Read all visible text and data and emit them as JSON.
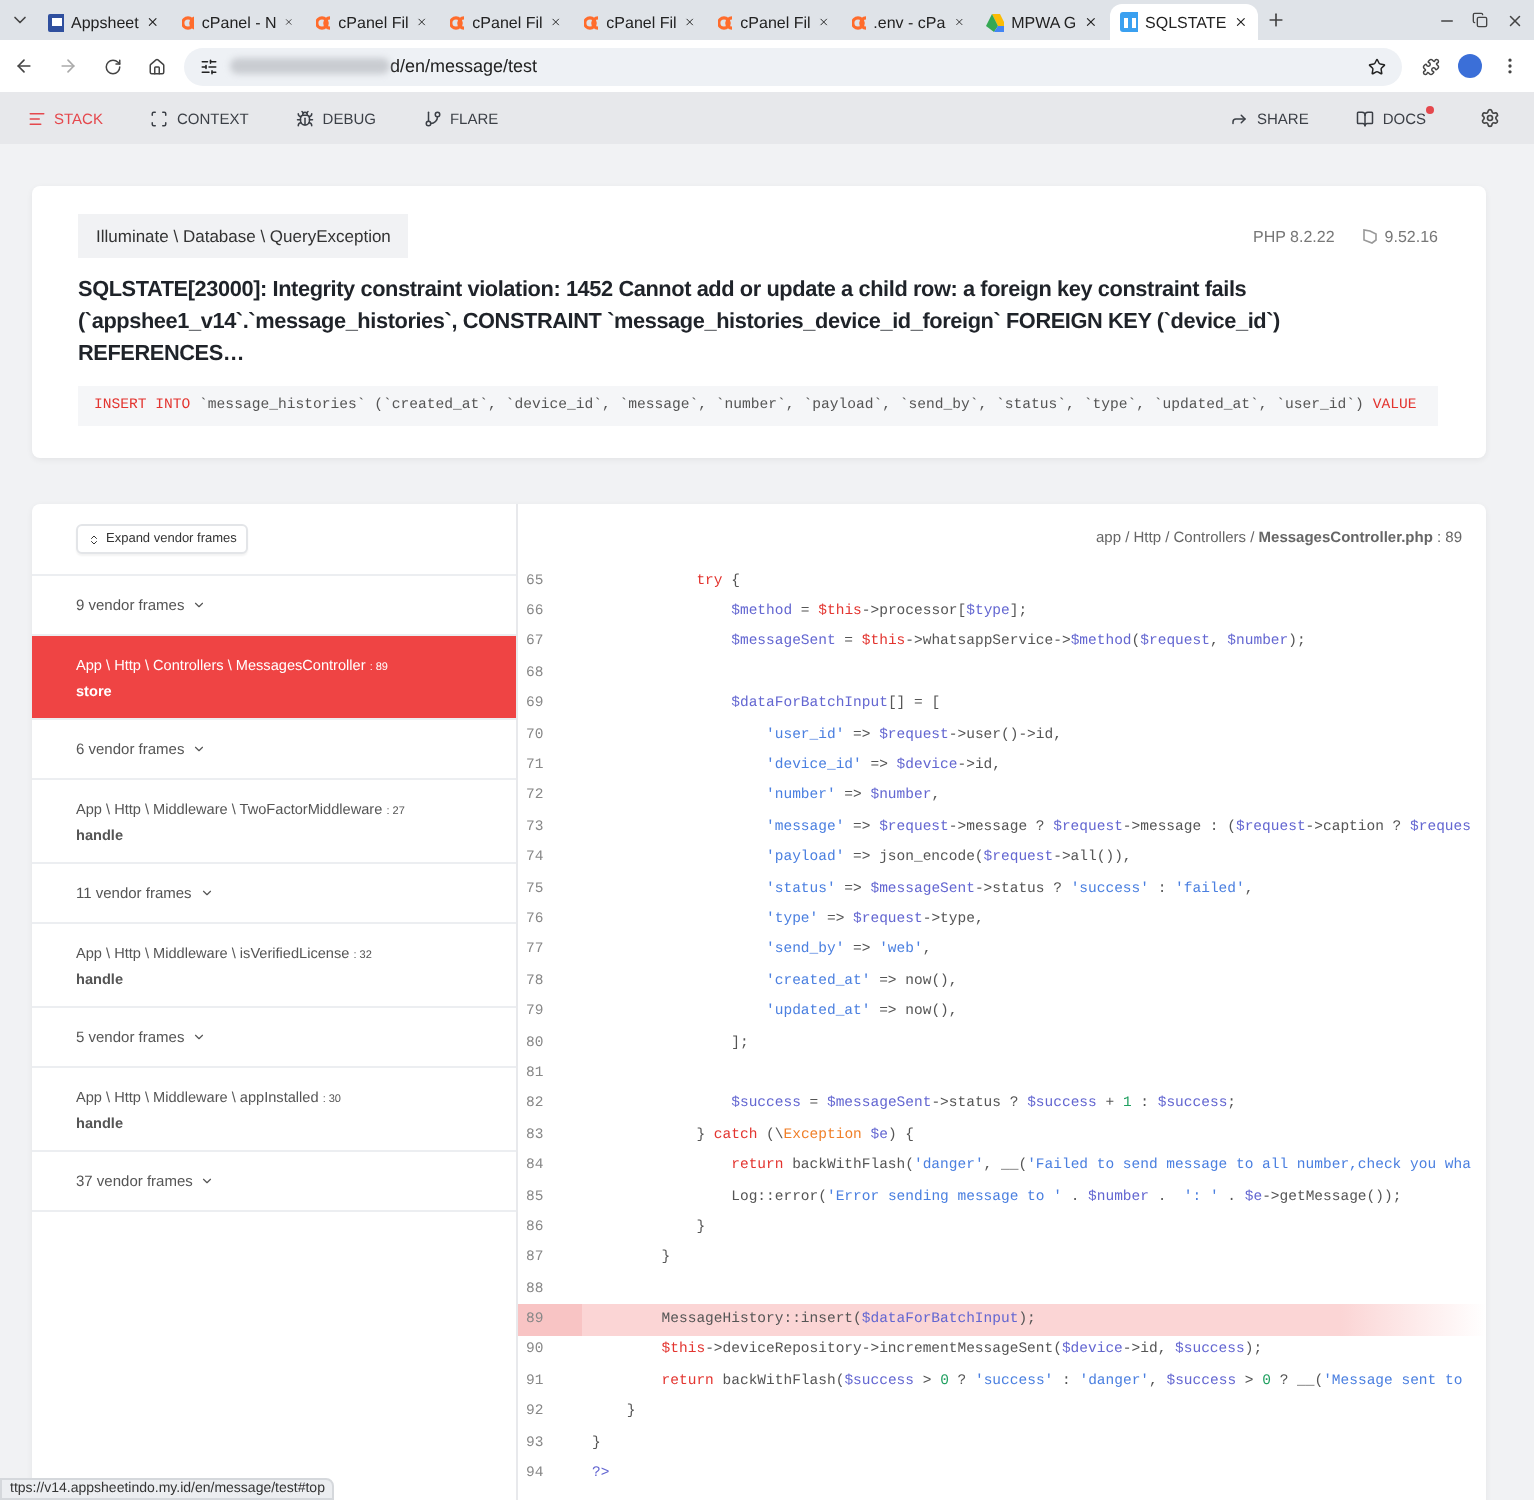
{
  "browser": {
    "tabs": [
      {
        "kind": "app",
        "title": "Appsheet",
        "selected": false
      },
      {
        "kind": "cpanel",
        "title": "cPanel - N",
        "selected": false
      },
      {
        "kind": "cpanel",
        "title": "cPanel Fil",
        "selected": false
      },
      {
        "kind": "cpanel",
        "title": "cPanel Fil",
        "selected": false
      },
      {
        "kind": "cpanel",
        "title": "cPanel Fil",
        "selected": false
      },
      {
        "kind": "cpanel",
        "title": "cPanel Fil",
        "selected": false
      },
      {
        "kind": "cpanel",
        "title": ".env - cPa",
        "selected": false
      },
      {
        "kind": "drive",
        "title": "MPWA G",
        "selected": false
      },
      {
        "kind": "ignition",
        "title": "SQLSTATE",
        "selected": true
      }
    ],
    "address": "d/en/message/test",
    "status_url": "ttps://v14.appsheetindo.my.id/en/message/test#top"
  },
  "nav": {
    "left": [
      {
        "kind": "stack",
        "label": "STACK",
        "selected": true
      },
      {
        "kind": "context",
        "label": "CONTEXT",
        "selected": false
      },
      {
        "kind": "debug",
        "label": "DEBUG",
        "selected": false
      },
      {
        "kind": "flare",
        "label": "FLARE",
        "selected": false
      }
    ],
    "right": [
      {
        "kind": "share",
        "label": "SHARE",
        "notification": false
      },
      {
        "kind": "docs",
        "label": "DOCS",
        "notification": true
      }
    ]
  },
  "exception": {
    "class": "Illuminate \\ Database \\ QueryException",
    "php": "PHP 8.2.22",
    "laravel": "9.52.16",
    "message": "SQLSTATE[23000]: Integrity constraint violation: 1452 Cannot add or update a child row: a foreign key constraint fails (`appshee1_v14`.`message_histories`, CONSTRAINT `message_histories_device_id_foreign` FOREIGN KEY (`device_id`) REFERENCES…",
    "sql": [
      {
        "kind": "keyword",
        "text": "INSERT INTO"
      },
      {
        "kind": "plain",
        "text": " `message_histories` (`created_at`, `device_id`, `message`, `number`, `payload`, `send_by`, `status`, `type`, `updated_at`, `user_id`) "
      },
      {
        "kind": "keyword",
        "text": "VALUE"
      }
    ]
  },
  "stack": {
    "expand_button": "Expand vendor frames",
    "frames": [
      {
        "kind": "vendor",
        "label": "9 vendor frames"
      },
      {
        "kind": "frame",
        "path": "App \\ Http \\ Controllers \\ MessagesController",
        "line": ": 89",
        "method": "store",
        "selected": true
      },
      {
        "kind": "vendor",
        "label": "6 vendor frames"
      },
      {
        "kind": "frame",
        "path": "App \\ Http \\ Middleware \\ TwoFactorMiddleware",
        "line": ": 27",
        "method": "handle",
        "selected": false
      },
      {
        "kind": "vendor",
        "label": "11 vendor frames"
      },
      {
        "kind": "frame",
        "path": "App \\ Http \\ Middleware \\ isVerifiedLicense",
        "line": ": 32",
        "method": "handle",
        "selected": false
      },
      {
        "kind": "vendor",
        "label": "5 vendor frames"
      },
      {
        "kind": "frame",
        "path": "App \\ Http \\ Middleware \\ appInstalled",
        "line": ": 30",
        "method": "handle",
        "selected": false
      },
      {
        "kind": "vendor",
        "label": "37 vendor frames"
      }
    ]
  },
  "code": {
    "file": "app / Http / Controllers / **MessagesController.php** : 89",
    "lines": [
      {
        "number": "65",
        "highlighted": false,
        "tokens": [
          {
            "kind": "keyword",
            "text": "            try"
          },
          {
            "kind": "plain",
            "text": " {"
          }
        ]
      },
      {
        "number": "66",
        "highlighted": false,
        "tokens": [
          {
            "kind": "variable",
            "text": "                $method"
          },
          {
            "kind": "plain",
            "text": " = "
          },
          {
            "kind": "keyword",
            "text": "$this"
          },
          {
            "kind": "plain",
            "text": "->processor["
          },
          {
            "kind": "variable",
            "text": "$type"
          },
          {
            "kind": "plain",
            "text": "];"
          }
        ]
      },
      {
        "number": "67",
        "highlighted": false,
        "tokens": [
          {
            "kind": "variable",
            "text": "                $messageSent"
          },
          {
            "kind": "plain",
            "text": " = "
          },
          {
            "kind": "keyword",
            "text": "$this"
          },
          {
            "kind": "plain",
            "text": "->whatsappService->"
          },
          {
            "kind": "variable",
            "text": "$method"
          },
          {
            "kind": "plain",
            "text": "("
          },
          {
            "kind": "variable",
            "text": "$request"
          },
          {
            "kind": "plain",
            "text": ", "
          },
          {
            "kind": "variable",
            "text": "$number"
          },
          {
            "kind": "plain",
            "text": ");"
          }
        ]
      },
      {
        "number": "68",
        "highlighted": false
      },
      {
        "number": "69",
        "highlighted": false,
        "tokens": [
          {
            "kind": "variable",
            "text": "                $dataForBatchInput"
          },
          {
            "kind": "plain",
            "text": "[] = ["
          }
        ]
      },
      {
        "number": "70",
        "highlighted": false,
        "tokens": [
          {
            "kind": "string",
            "text": "                    'user_id'"
          },
          {
            "kind": "plain",
            "text": " => "
          },
          {
            "kind": "variable",
            "text": "$request"
          },
          {
            "kind": "plain",
            "text": "->user()->id,"
          }
        ]
      },
      {
        "number": "71",
        "highlighted": false,
        "tokens": [
          {
            "kind": "string",
            "text": "                    'device_id'"
          },
          {
            "kind": "plain",
            "text": " => "
          },
          {
            "kind": "variable",
            "text": "$device"
          },
          {
            "kind": "plain",
            "text": "->id,"
          }
        ]
      },
      {
        "number": "72",
        "highlighted": false,
        "tokens": [
          {
            "kind": "string",
            "text": "                    'number'"
          },
          {
            "kind": "plain",
            "text": " => "
          },
          {
            "kind": "variable",
            "text": "$number"
          },
          {
            "kind": "plain",
            "text": ","
          }
        ]
      },
      {
        "number": "73",
        "highlighted": false,
        "tokens": [
          {
            "kind": "string",
            "text": "                    'message'"
          },
          {
            "kind": "plain",
            "text": " => "
          },
          {
            "kind": "variable",
            "text": "$request"
          },
          {
            "kind": "plain",
            "text": "->message ? "
          },
          {
            "kind": "variable",
            "text": "$request"
          },
          {
            "kind": "plain",
            "text": "->message : ("
          },
          {
            "kind": "variable",
            "text": "$request"
          },
          {
            "kind": "plain",
            "text": "->caption ? "
          },
          {
            "kind": "variable",
            "text": "$reques"
          }
        ]
      },
      {
        "number": "74",
        "highlighted": false,
        "tokens": [
          {
            "kind": "string",
            "text": "                    'payload'"
          },
          {
            "kind": "plain",
            "text": " => json_encode("
          },
          {
            "kind": "variable",
            "text": "$request"
          },
          {
            "kind": "plain",
            "text": "->all()),"
          }
        ]
      },
      {
        "number": "75",
        "highlighted": false,
        "tokens": [
          {
            "kind": "string",
            "text": "                    'status'"
          },
          {
            "kind": "plain",
            "text": " => "
          },
          {
            "kind": "variable",
            "text": "$messageSent"
          },
          {
            "kind": "plain",
            "text": "->status ? "
          },
          {
            "kind": "string",
            "text": "'success'"
          },
          {
            "kind": "plain",
            "text": " : "
          },
          {
            "kind": "string",
            "text": "'failed'"
          },
          {
            "kind": "plain",
            "text": ","
          }
        ]
      },
      {
        "number": "76",
        "highlighted": false,
        "tokens": [
          {
            "kind": "string",
            "text": "                    'type'"
          },
          {
            "kind": "plain",
            "text": " => "
          },
          {
            "kind": "variable",
            "text": "$request"
          },
          {
            "kind": "plain",
            "text": "->type,"
          }
        ]
      },
      {
        "number": "77",
        "highlighted": false,
        "tokens": [
          {
            "kind": "string",
            "text": "                    'send_by'"
          },
          {
            "kind": "plain",
            "text": " => "
          },
          {
            "kind": "string",
            "text": "'web'"
          },
          {
            "kind": "plain",
            "text": ","
          }
        ]
      },
      {
        "number": "78",
        "highlighted": false,
        "tokens": [
          {
            "kind": "string",
            "text": "                    'created_at'"
          },
          {
            "kind": "plain",
            "text": " => now(),"
          }
        ]
      },
      {
        "number": "79",
        "highlighted": false,
        "tokens": [
          {
            "kind": "string",
            "text": "                    'updated_at'"
          },
          {
            "kind": "plain",
            "text": " => now(),"
          }
        ]
      },
      {
        "number": "80",
        "highlighted": false,
        "tokens": [
          {
            "kind": "plain",
            "text": "                ];"
          }
        ]
      },
      {
        "number": "81",
        "highlighted": false
      },
      {
        "number": "82",
        "highlighted": false,
        "tokens": [
          {
            "kind": "variable",
            "text": "                $success"
          },
          {
            "kind": "plain",
            "text": " = "
          },
          {
            "kind": "variable",
            "text": "$messageSent"
          },
          {
            "kind": "plain",
            "text": "->status ? "
          },
          {
            "kind": "variable",
            "text": "$success"
          },
          {
            "kind": "plain",
            "text": " + "
          },
          {
            "kind": "number",
            "text": "1"
          },
          {
            "kind": "plain",
            "text": " : "
          },
          {
            "kind": "variable",
            "text": "$success"
          },
          {
            "kind": "plain",
            "text": ";"
          }
        ]
      },
      {
        "number": "83",
        "highlighted": false,
        "tokens": [
          {
            "kind": "plain",
            "text": "            } "
          },
          {
            "kind": "keyword",
            "text": "catch"
          },
          {
            "kind": "plain",
            "text": " (\\"
          },
          {
            "kind": "class",
            "text": "Exception"
          },
          {
            "kind": "variable",
            "text": " $e"
          },
          {
            "kind": "plain",
            "text": ") {"
          }
        ]
      },
      {
        "number": "84",
        "highlighted": false,
        "tokens": [
          {
            "kind": "keyword",
            "text": "                return"
          },
          {
            "kind": "plain",
            "text": " backWithFlash("
          },
          {
            "kind": "string",
            "text": "'danger'"
          },
          {
            "kind": "plain",
            "text": ", __("
          },
          {
            "kind": "string",
            "text": "'Failed to send message to all number,check you wha"
          }
        ]
      },
      {
        "number": "85",
        "highlighted": false,
        "tokens": [
          {
            "kind": "plain",
            "text": "                Log::error("
          },
          {
            "kind": "string",
            "text": "'Error sending message to '"
          },
          {
            "kind": "plain",
            "text": " . "
          },
          {
            "kind": "variable",
            "text": "$number"
          },
          {
            "kind": "plain",
            "text": " .  "
          },
          {
            "kind": "string",
            "text": "': '"
          },
          {
            "kind": "plain",
            "text": " . "
          },
          {
            "kind": "variable",
            "text": "$e"
          },
          {
            "kind": "plain",
            "text": "->getMessage());"
          }
        ]
      },
      {
        "number": "86",
        "highlighted": false,
        "tokens": [
          {
            "kind": "plain",
            "text": "            }"
          }
        ]
      },
      {
        "number": "87",
        "highlighted": false,
        "tokens": [
          {
            "kind": "plain",
            "text": "        }"
          }
        ]
      },
      {
        "number": "88",
        "highlighted": false
      },
      {
        "number": "89",
        "highlighted": true,
        "tokens": [
          {
            "kind": "plain",
            "text": "        MessageHistory::insert("
          },
          {
            "kind": "variable",
            "text": "$dataForBatchInput"
          },
          {
            "kind": "plain",
            "text": ");"
          }
        ]
      },
      {
        "number": "90",
        "highlighted": false,
        "tokens": [
          {
            "kind": "keyword",
            "text": "        $this"
          },
          {
            "kind": "plain",
            "text": "->deviceRepository->incrementMessageSent("
          },
          {
            "kind": "variable",
            "text": "$device"
          },
          {
            "kind": "plain",
            "text": "->id, "
          },
          {
            "kind": "variable",
            "text": "$success"
          },
          {
            "kind": "plain",
            "text": ");"
          }
        ]
      },
      {
        "number": "91",
        "highlighted": false,
        "tokens": [
          {
            "kind": "keyword",
            "text": "        return"
          },
          {
            "kind": "plain",
            "text": " backWithFlash("
          },
          {
            "kind": "variable",
            "text": "$success"
          },
          {
            "kind": "plain",
            "text": " > "
          },
          {
            "kind": "number",
            "text": "0"
          },
          {
            "kind": "plain",
            "text": " ? "
          },
          {
            "kind": "string",
            "text": "'success'"
          },
          {
            "kind": "plain",
            "text": " : "
          },
          {
            "kind": "string",
            "text": "'danger'"
          },
          {
            "kind": "plain",
            "text": ", "
          },
          {
            "kind": "variable",
            "text": "$success"
          },
          {
            "kind": "plain",
            "text": " > "
          },
          {
            "kind": "number",
            "text": "0"
          },
          {
            "kind": "plain",
            "text": " ? __("
          },
          {
            "kind": "string",
            "text": "'Message sent to"
          }
        ]
      },
      {
        "number": "92",
        "highlighted": false,
        "tokens": [
          {
            "kind": "plain",
            "text": "    }"
          }
        ]
      },
      {
        "number": "93",
        "highlighted": false,
        "tokens": [
          {
            "kind": "plain",
            "text": "}"
          }
        ]
      },
      {
        "number": "94",
        "highlighted": false,
        "tokens": [
          {
            "kind": "variable",
            "text": "?>"
          }
        ]
      }
    ]
  }
}
